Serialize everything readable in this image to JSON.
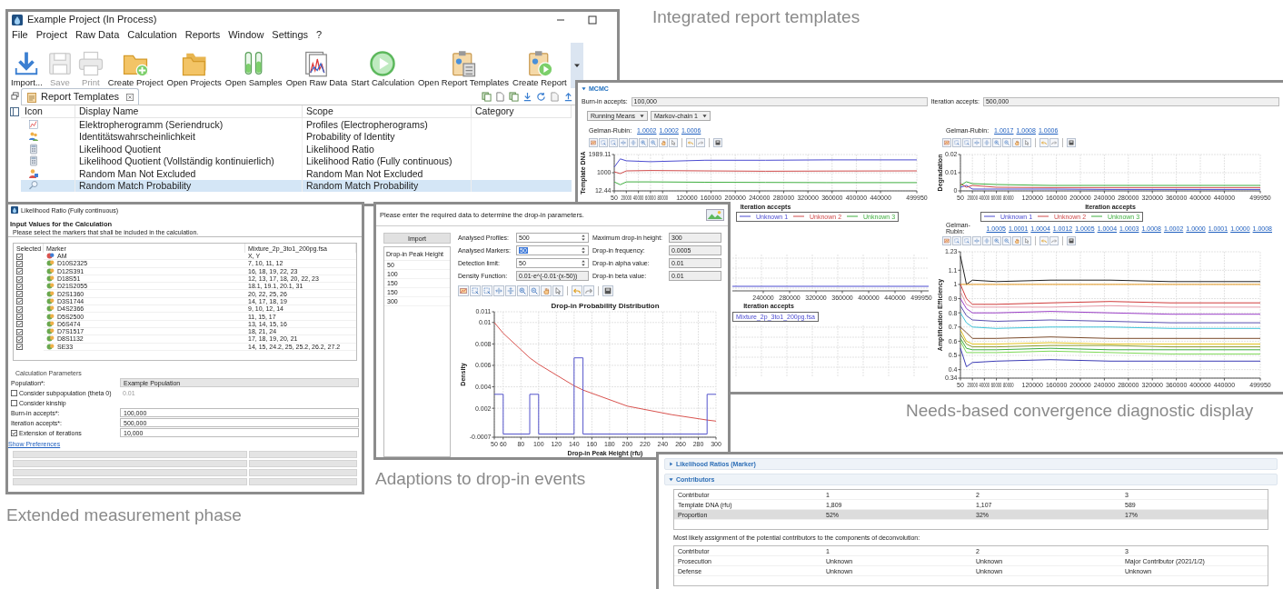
{
  "report_window": {
    "caption": "Integrated report templates",
    "title": "Example Project (In Process)",
    "menu": [
      "File",
      "Project",
      "Raw Data",
      "Calculation",
      "Reports",
      "Window",
      "Settings",
      "?"
    ],
    "toolbar": [
      {
        "label": "Import...",
        "kind": "import",
        "disabled": false
      },
      {
        "label": "Save",
        "kind": "save",
        "disabled": true
      },
      {
        "label": "Print",
        "kind": "print",
        "disabled": true
      },
      {
        "label": "Create Project",
        "kind": "new-folder",
        "disabled": false
      },
      {
        "label": "Open Projects",
        "kind": "folders",
        "disabled": false
      },
      {
        "label": "Open Samples",
        "kind": "tubes",
        "disabled": false
      },
      {
        "label": "Open Raw Data",
        "kind": "raw-data",
        "disabled": false
      },
      {
        "label": "Start Calculation",
        "kind": "play",
        "disabled": false
      },
      {
        "label": "Open Report Templates",
        "kind": "report-calc",
        "disabled": false
      },
      {
        "label": "Create Report",
        "kind": "report-play",
        "disabled": false
      }
    ],
    "tab": {
      "label": "Report Templates",
      "selected": true
    },
    "table": {
      "columns": [
        "Icon",
        "Display Name",
        "Scope",
        "Category"
      ],
      "rows": [
        {
          "kind": "chart",
          "name": "Elektropherogramm (Seriendruck)",
          "scope": "Profiles (Electropherograms)",
          "selected": false
        },
        {
          "kind": "people",
          "name": "Identitätswahrscheinlichkeit",
          "scope": "Probability of Identity",
          "selected": false
        },
        {
          "kind": "calculator",
          "name": "Likelihood Quotient",
          "scope": "Likelihood Ratio",
          "selected": false
        },
        {
          "kind": "calculator",
          "name": "Likelihood Quotient (Vollständig kontinuierlich)",
          "scope": "Likelihood Ratio (Fully continuous)",
          "selected": false
        },
        {
          "kind": "person",
          "name": "Random Man Not Excluded",
          "scope": "Random Man Not Excluded",
          "selected": false
        },
        {
          "kind": "search",
          "name": "Random Match Probability",
          "scope": "Random Match Probability",
          "selected": true
        }
      ]
    }
  },
  "mcmc_window": {
    "caption": "Needs-based convergence diagnostic display",
    "section": {
      "title": "MCMC",
      "expanded": true
    },
    "burn_in": {
      "label": "Burn-in accepts:",
      "value": "100,000"
    },
    "iterations": {
      "label": "Iteration accepts:",
      "value": "500,000"
    },
    "dropdowns": [
      "Running Means",
      "Markov-chain 1"
    ],
    "top_left": {
      "gelman": {
        "label": "Gelman-Rubin:",
        "values": [
          "1.0002",
          "1.0002",
          "1.0006"
        ]
      },
      "chart_data": {
        "type": "line",
        "grid": true,
        "xlabel": "Iteration accepts",
        "ylabel": "Template DNA",
        "x": [
          50,
          10000,
          20000,
          60000,
          150000,
          250000,
          350000,
          499950
        ],
        "xlim": [
          50,
          499950
        ],
        "ylim": [
          12.44,
          1989.11
        ],
        "yticks": [
          12.44,
          1000,
          1989.11
        ],
        "xticks": [
          50,
          20000,
          40000,
          60000,
          80000,
          120000,
          160000,
          200000,
          240000,
          280000,
          320000,
          360000,
          400000,
          440000,
          499950
        ],
        "series": [
          {
            "name": "Unknown 1",
            "color": "#4b4bd0",
            "values": [
              1300,
              1750,
              1650,
              1600,
              1680,
              1680,
              1700,
              1700
            ]
          },
          {
            "name": "Unknown 2",
            "color": "#d04b4b",
            "values": [
              1050,
              950,
              1100,
              1120,
              1100,
              1080,
              1090,
              1100
            ]
          },
          {
            "name": "Unknown 3",
            "color": "#3fae3f",
            "values": [
              500,
              350,
              500,
              500,
              480,
              470,
              460,
              460
            ]
          }
        ]
      }
    },
    "top_right": {
      "gelman": {
        "label": "Gelman-Rubin:",
        "values": [
          "1.0017",
          "1.0008",
          "1.0006"
        ]
      },
      "chart_data": {
        "type": "line",
        "grid": true,
        "xlabel": "Iteration accepts",
        "ylabel": "Degradation",
        "x": [
          50,
          10000,
          20000,
          60000,
          150000,
          250000,
          350000,
          499950
        ],
        "xlim": [
          50,
          499950
        ],
        "ylim": [
          0,
          0.02
        ],
        "yticks": [
          0,
          0.01,
          0.02
        ],
        "xticks": [
          50,
          20000,
          40000,
          60000,
          80000,
          120000,
          160000,
          200000,
          240000,
          280000,
          320000,
          360000,
          400000,
          440000,
          499950
        ],
        "series": [
          {
            "name": "Unknown 1",
            "color": "#4b4bd0",
            "values": [
              0.002,
              0.003,
              0.001,
              0.001,
              0.001,
              0.0008,
              0.0008,
              0.0008
            ]
          },
          {
            "name": "Unknown 2",
            "color": "#d04b4b",
            "values": [
              0.004,
              0.002,
              0.003,
              0.002,
              0.0018,
              0.0018,
              0.0018,
              0.0018
            ]
          },
          {
            "name": "Unknown 3",
            "color": "#3fae3f",
            "values": [
              0.003,
              0.005,
              0.004,
              0.0035,
              0.003,
              0.003,
              0.003,
              0.003
            ]
          }
        ]
      }
    },
    "partial_chart": {
      "xticks": [
        "240000",
        "280000",
        "320000",
        "360000",
        "400000",
        "440000",
        "499950"
      ],
      "xlabel": "Iteration accepts",
      "legend": "Mixture_2p_3to1_200pg.fsa"
    },
    "bottom_right": {
      "gelman": {
        "label": "Gelman-Rubin:",
        "values": [
          "1.0005",
          "1.0001",
          "1.0004",
          "1.0012",
          "1.0005",
          "1.0004",
          "1.0003",
          "1.0008",
          "1.0002",
          "1.0000",
          "1.0001",
          "1.0000",
          "1.0008"
        ]
      },
      "chart_data": {
        "type": "line",
        "grid": true,
        "ylabel": "Amplification Efficiency",
        "x": [
          50,
          10000,
          20000,
          60000,
          150000,
          250000,
          350000,
          499950
        ],
        "xlim": [
          50,
          499950
        ],
        "ylim": [
          0.34,
          1.23
        ],
        "yticks": [
          0.34,
          0.4,
          0.5,
          0.6,
          0.7,
          0.8,
          0.9,
          1,
          1.1,
          1.23
        ],
        "xticks": [
          50,
          20000,
          40000,
          60000,
          80000,
          120000,
          160000,
          200000,
          240000,
          280000,
          320000,
          360000,
          400000,
          440000,
          499950
        ],
        "series": [
          {
            "color": "#222222",
            "values": [
              1.2,
              1.0,
              1.03,
              1.02,
              1.03,
              1.03,
              1.02,
              1.02
            ]
          },
          {
            "color": "#e69a1e",
            "values": [
              1.0,
              1.0,
              1.0,
              1.0,
              1.0,
              1.0,
              1.0,
              1.0
            ]
          },
          {
            "color": "#d03b3b",
            "values": [
              1.0,
              0.9,
              0.86,
              0.86,
              0.87,
              0.88,
              0.87,
              0.87
            ]
          },
          {
            "color": "#e59aa8",
            "values": [
              0.95,
              0.86,
              0.84,
              0.84,
              0.84,
              0.85,
              0.84,
              0.84
            ]
          },
          {
            "color": "#9b3fc7",
            "values": [
              0.9,
              0.83,
              0.8,
              0.8,
              0.81,
              0.8,
              0.79,
              0.79
            ]
          },
          {
            "color": "#5a4fb0",
            "values": [
              0.85,
              0.78,
              0.75,
              0.74,
              0.75,
              0.74,
              0.73,
              0.73
            ]
          },
          {
            "color": "#3fc4d9",
            "values": [
              0.8,
              0.73,
              0.7,
              0.69,
              0.7,
              0.7,
              0.69,
              0.69
            ]
          },
          {
            "color": "#7a4a2a",
            "values": [
              0.7,
              0.66,
              0.62,
              0.62,
              0.63,
              0.62,
              0.62,
              0.62
            ]
          },
          {
            "color": "#e3c21e",
            "values": [
              0.68,
              0.6,
              0.58,
              0.58,
              0.59,
              0.58,
              0.58,
              0.58
            ]
          },
          {
            "color": "#8a9a2a",
            "values": [
              0.65,
              0.58,
              0.56,
              0.56,
              0.57,
              0.57,
              0.56,
              0.56
            ]
          },
          {
            "color": "#3fae3f",
            "values": [
              0.62,
              0.55,
              0.54,
              0.54,
              0.55,
              0.54,
              0.54,
              0.54
            ]
          },
          {
            "color": "#7ed957",
            "values": [
              0.6,
              0.52,
              0.52,
              0.52,
              0.53,
              0.52,
              0.51,
              0.51
            ]
          },
          {
            "color": "#3b3bb5",
            "values": [
              0.55,
              0.42,
              0.45,
              0.46,
              0.47,
              0.46,
              0.46,
              0.46
            ]
          }
        ]
      }
    }
  },
  "ratio_window": {
    "caption": "Extended measurement phase",
    "title": "Likelihood Ratio (Fully continuous)",
    "heading": "Input Values for the Calculation",
    "instruction": "Please select the markers that shall be included in the calculation.",
    "table": {
      "columns": [
        "Selected",
        "Marker",
        "Mixture_2p_3to1_200pg.fsa"
      ],
      "rows": [
        {
          "kind": "am",
          "checked": true,
          "marker": "AM",
          "alleles": "X, Y"
        },
        {
          "kind": "str",
          "checked": true,
          "marker": "D10S2325",
          "alleles": "7, 10, 11, 12"
        },
        {
          "kind": "str",
          "checked": true,
          "marker": "D12S391",
          "alleles": "16, 18, 19, 22, 23"
        },
        {
          "kind": "str",
          "checked": true,
          "marker": "D18S51",
          "alleles": "12, 13, 17, 18, 20, 22, 23"
        },
        {
          "kind": "str",
          "checked": true,
          "marker": "D21S2055",
          "alleles": "18.1, 19.1, 20.1, 31"
        },
        {
          "kind": "str",
          "checked": true,
          "marker": "D2S1360",
          "alleles": "20, 22, 25, 26"
        },
        {
          "kind": "str",
          "checked": true,
          "marker": "D3S1744",
          "alleles": "14, 17, 18, 19"
        },
        {
          "kind": "str",
          "checked": true,
          "marker": "D4S2366",
          "alleles": "9, 10, 12, 14"
        },
        {
          "kind": "str",
          "checked": true,
          "marker": "D5S2500",
          "alleles": "11, 15, 17"
        },
        {
          "kind": "str",
          "checked": true,
          "marker": "D6S474",
          "alleles": "13, 14, 15, 16"
        },
        {
          "kind": "str",
          "checked": true,
          "marker": "D7S1517",
          "alleles": "18, 21, 24"
        },
        {
          "kind": "str",
          "checked": true,
          "marker": "D8S1132",
          "alleles": "17, 18, 19, 20, 21"
        },
        {
          "kind": "str",
          "checked": true,
          "marker": "SE33",
          "alleles": "14, 15, 24.2, 25, 25.2, 26.2, 27.2"
        }
      ]
    },
    "parameters": {
      "legend": "Calculation Parameters",
      "rows": [
        {
          "kind": "select",
          "label": "Population*:",
          "value": "Example Population"
        },
        {
          "kind": "check",
          "label": "Consider subpopulation (theta 0)",
          "checked": false,
          "value": "0.01"
        },
        {
          "kind": "check",
          "label": "Consider kinship",
          "checked": false
        },
        {
          "kind": "field",
          "label": "Burn-in accepts*:",
          "value": "100,000"
        },
        {
          "kind": "field",
          "label": "Iteration accepts*:",
          "value": "500,000"
        },
        {
          "kind": "check",
          "label": "Extension of iterations",
          "checked": true,
          "value": "10,000"
        }
      ]
    },
    "link": "Show Preferences"
  },
  "dropin_window": {
    "caption": "Adaptions to drop-in events",
    "instruction": "Please enter the required data to determine the drop-in parameters.",
    "import_label": "Import",
    "list": {
      "header": "Drop-in Peak Height",
      "items": [
        "50",
        "100",
        "150",
        "150",
        "300"
      ]
    },
    "rows": [
      {
        "left": {
          "label": "Analysed Profiles:",
          "value": "500",
          "kind": "spinner",
          "selected": false
        },
        "right": {
          "label": "Maximum drop-in height:",
          "value": "300"
        }
      },
      {
        "left": {
          "label": "Analysed Markers:",
          "value": "50",
          "kind": "spinner",
          "selected": true
        },
        "right": {
          "label": "Drop-in frequency:",
          "value": "0.0005"
        }
      },
      {
        "left": {
          "label": "Detection limit:",
          "value": "50",
          "kind": "spinner",
          "selected": false
        },
        "right": {
          "label": "Drop-in alpha value:",
          "value": "0.01"
        }
      },
      {
        "left": {
          "label": "Density Function:",
          "value": "0.01·e^(-0.01·(x-50))",
          "kind": "readonly",
          "selected": false
        },
        "right": {
          "label": "Drop-in beta value:",
          "value": "0.01"
        }
      }
    ],
    "chart_data": {
      "type": "line",
      "grid": true,
      "title": "Drop-in Probability Distribution",
      "xlabel": "Drop-in Peak Height (rfu)",
      "ylabel": "Density",
      "x": [
        50,
        60,
        60,
        90,
        90,
        100,
        100,
        140,
        140,
        150,
        150,
        200,
        250,
        290,
        290,
        300
      ],
      "xlim": [
        50,
        300
      ],
      "ylim": [
        -0.0007,
        0.011
      ],
      "xticks": [
        50,
        60,
        80,
        100,
        120,
        140,
        160,
        180,
        200,
        220,
        240,
        260,
        280,
        300
      ],
      "yticks": [
        -0.0007,
        0.002,
        0.004,
        0.006,
        0.008,
        0.01,
        0.011
      ],
      "series": [
        {
          "color": "#d9534f",
          "values": [
            0.01,
            0.009,
            0.009,
            0.0067,
            0.0067,
            0.0061,
            0.0061,
            0.0041,
            0.0041,
            0.0037,
            0.0037,
            0.0022,
            0.0014,
            0.0009,
            0.0009,
            0.0008
          ]
        },
        {
          "color": "#5555cc",
          "values": [
            0.0033,
            0.0033,
            -0.0004,
            -0.0004,
            0.0033,
            0.0033,
            -0.0004,
            -0.0004,
            0.0067,
            0.0067,
            -0.0004,
            -0.0004,
            -0.0004,
            -0.0004,
            0.0033,
            0.0033
          ]
        }
      ]
    }
  },
  "contributors_window": {
    "sections": [
      {
        "title": "Likelihood Ratios (Marker)",
        "expanded": false
      },
      {
        "title": "Contributors",
        "expanded": true
      }
    ],
    "table1": {
      "rows": [
        {
          "cells": [
            "Contributor",
            "1",
            "2",
            "3"
          ],
          "selected": false
        },
        {
          "cells": [
            "Template DNA (rfu)",
            "1,809",
            "1,107",
            "589"
          ],
          "selected": false
        },
        {
          "cells": [
            "Proportion",
            "52%",
            "32%",
            "17%"
          ],
          "selected": true
        }
      ]
    },
    "assignment_text": "Most likely assignment of the potential contributors to the components of deconvolution:",
    "table2": {
      "rows": [
        {
          "cells": [
            "Contributor",
            "1",
            "2",
            "3"
          ],
          "selected": false
        },
        {
          "cells": [
            "Prosecution",
            "Unknown",
            "Unknown",
            "Major Contributor (2021/1/2)"
          ],
          "selected": false
        },
        {
          "cells": [
            "Defense",
            "Unknown",
            "Unknown",
            "Unknown"
          ],
          "selected": false
        }
      ]
    }
  }
}
